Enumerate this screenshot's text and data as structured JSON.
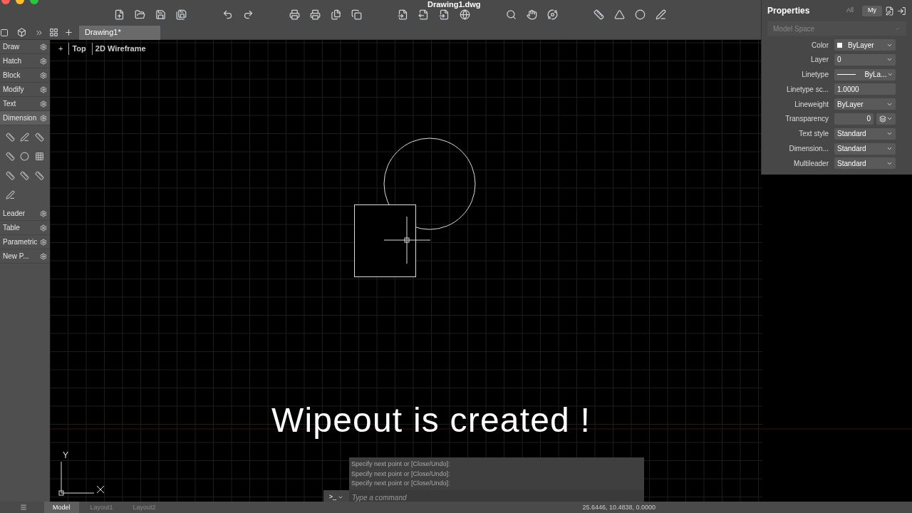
{
  "window": {
    "title": "Drawing1.dwg"
  },
  "document_tabs": [
    {
      "label": "Drawing1*",
      "selected": true
    }
  ],
  "viewport_controls": [
    "+",
    "Top",
    "2D Wireframe"
  ],
  "tool_palette": [
    {
      "label": "Draw",
      "expanded": false
    },
    {
      "label": "Hatch",
      "expanded": false
    },
    {
      "label": "Block",
      "expanded": false
    },
    {
      "label": "Modify",
      "expanded": false
    },
    {
      "label": "Text",
      "expanded": false
    },
    {
      "label": "Dimension",
      "expanded": true
    },
    {
      "label": "Leader",
      "expanded": false
    },
    {
      "label": "Table",
      "expanded": false
    },
    {
      "label": "Parametric",
      "expanded": false
    },
    {
      "label": "New P...",
      "expanded": false
    }
  ],
  "properties": {
    "title": "Properties",
    "filters": [
      {
        "label": "All",
        "selected": false
      },
      {
        "label": "My",
        "selected": true
      }
    ],
    "selector": "Model Space",
    "rows": [
      {
        "label": "Color",
        "kind": "color",
        "value": "ByLayer"
      },
      {
        "label": "Layer",
        "kind": "dropdown",
        "value": "0"
      },
      {
        "label": "Linetype",
        "kind": "linetype",
        "value": "ByLa..."
      },
      {
        "label": "Linetype sc...",
        "kind": "input",
        "value": "1.0000"
      },
      {
        "label": "Lineweight",
        "kind": "dropdown",
        "value": "ByLayer"
      },
      {
        "label": "Transparency",
        "kind": "transparency",
        "value": "0"
      },
      {
        "label": "Text style",
        "kind": "dropdown",
        "value": "Standard"
      },
      {
        "label": "Dimension...",
        "kind": "dropdown",
        "value": "Standard"
      },
      {
        "label": "Multileader",
        "kind": "dropdown",
        "value": "Standard"
      }
    ]
  },
  "caption": "Wipeout is created !",
  "ucs": {
    "y_label": "Y"
  },
  "command_line": {
    "history": [
      "Specify next point or [Close/Undo]:",
      "Specify next point or [Close/Undo]:",
      "Specify next point or [Close/Undo]:"
    ],
    "prompt": ">_",
    "placeholder": "Type a command"
  },
  "status_bar": {
    "layout_tabs": [
      {
        "label": "Model",
        "selected": true
      },
      {
        "label": "Layout1",
        "selected": false
      },
      {
        "label": "Layout2",
        "selected": false
      }
    ],
    "coordinates": "25.6446, 10.4838, 0.0000"
  }
}
